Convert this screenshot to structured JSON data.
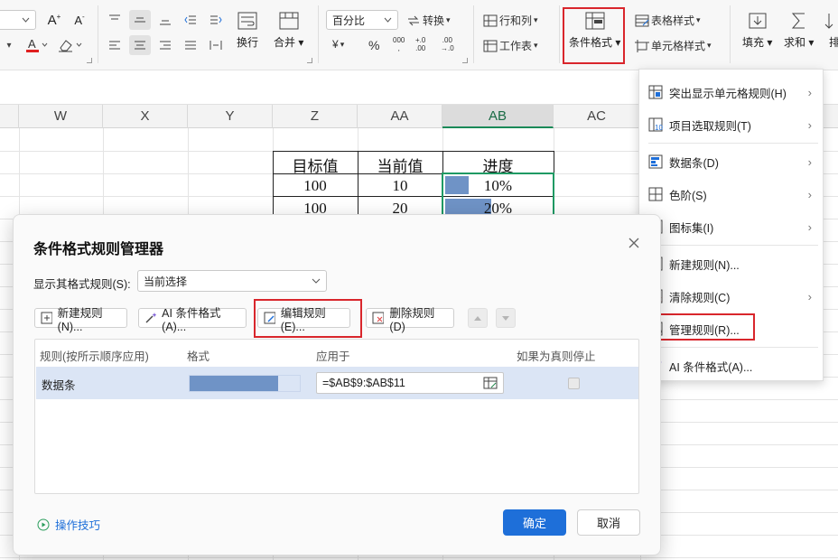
{
  "ribbon": {
    "font_grow": "A",
    "font_shrink": "A",
    "wrap_label": "换行",
    "merge_label": "合并",
    "number_format_value": "百分比",
    "convert_label": "转换",
    "rowcol_label": "行和列",
    "sheet_label": "工作表",
    "conditional_format_label": "条件格式",
    "table_style_label": "表格样式",
    "cell_style_label": "单元格样式",
    "fill_label": "填充",
    "sum_label": "求和",
    "sort_label": "排",
    "currency_symbol": "¥",
    "percent_symbol": "%",
    "thousands_symbol": "000"
  },
  "sheet": {
    "columns": [
      "W",
      "X",
      "Y",
      "Z",
      "AA",
      "AB",
      "AC"
    ],
    "selected_column": "AB",
    "table": {
      "headers": [
        "目标值",
        "当前值",
        "进度"
      ],
      "rows": [
        {
          "target": "100",
          "current": "10",
          "progress": "10%",
          "progress_value": 0.1
        },
        {
          "target": "100",
          "current": "20",
          "progress": "20%",
          "progress_value": 0.2
        }
      ]
    },
    "data_bar_color": "#6f93c6"
  },
  "dropdown": {
    "items": [
      {
        "label": "突出显示单元格规则(H)",
        "icon": "highlight-rules-icon",
        "submenu": true
      },
      {
        "label": "项目选取规则(T)",
        "icon": "top-bottom-rules-icon",
        "submenu": true
      },
      {
        "label": "数据条(D)",
        "icon": "data-bars-icon",
        "submenu": true
      },
      {
        "label": "色阶(S)",
        "icon": "color-scales-icon",
        "submenu": true
      },
      {
        "label": "图标集(I)",
        "icon": "icon-sets-icon",
        "submenu": true
      },
      {
        "label": "新建规则(N)...",
        "icon": "new-rule-icon",
        "submenu": false
      },
      {
        "label": "清除规则(C)",
        "icon": "clear-rules-icon",
        "submenu": true
      },
      {
        "label": "管理规则(R)...",
        "icon": "manage-rules-icon",
        "submenu": false
      },
      {
        "label": "AI 条件格式(A)...",
        "icon": "ai-format-icon",
        "submenu": false
      }
    ]
  },
  "dialog": {
    "title": "条件格式规则管理器",
    "show_rules_label": "显示其格式规则(S):",
    "show_rules_value": "当前选择",
    "new_rule_button": "新建规则(N)...",
    "ai_format_button": "AI 条件格式(A)...",
    "edit_rule_button": "编辑规则(E)...",
    "delete_rule_button": "删除规则(D)",
    "columns": {
      "rule": "规则(按所示顺序应用)",
      "format": "格式",
      "applies_to": "应用于",
      "stop_if_true": "如果为真则停止"
    },
    "rules": [
      {
        "rule": "数据条",
        "applies_to": "=$AB$9:$AB$11",
        "stop_if_true": false
      }
    ],
    "tips_link": "操作技巧",
    "ok_button": "确定",
    "cancel_button": "取消",
    "accent_color": "#1e6fd9",
    "highlight_color": "#d9262c"
  }
}
